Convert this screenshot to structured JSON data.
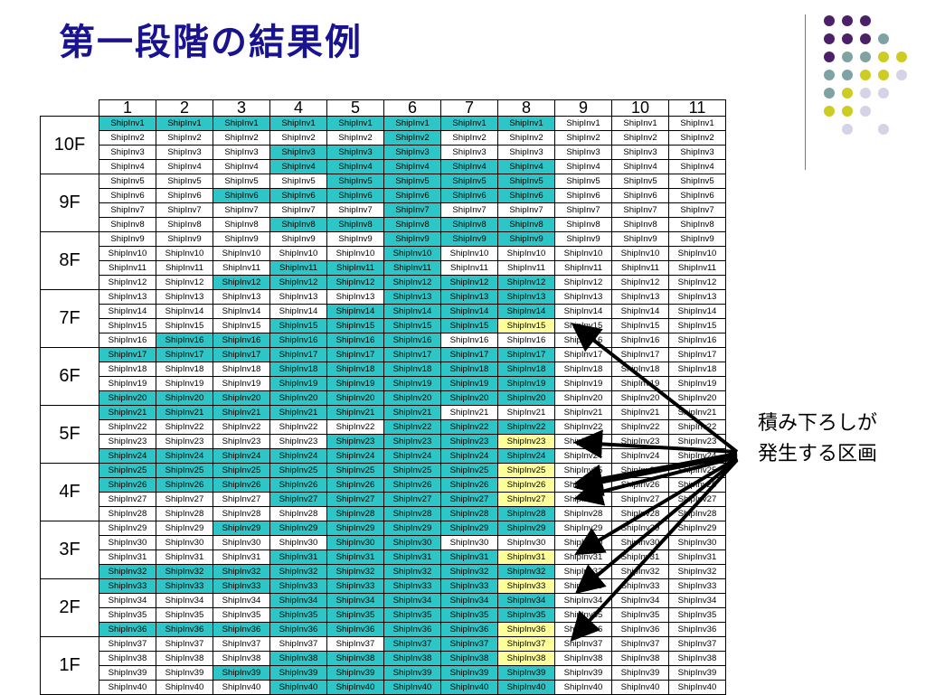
{
  "slide": {
    "title": "第一段階の結果例",
    "side_label_line1": "積み下ろしが",
    "side_label_line2": "発生する区画"
  },
  "colors": {
    "cyan": "#2ec5c6",
    "yellow": "#ffff99",
    "white": "#ffffff",
    "title": "#1a1390"
  },
  "grid": {
    "columns": [
      "1",
      "2",
      "3",
      "4",
      "5",
      "6",
      "7",
      "8",
      "9",
      "10",
      "11"
    ],
    "floors": [
      {
        "label": "10F",
        "rows": [
          {
            "text": "ShipInv1",
            "colors": "CCCCCCCCWWW"
          },
          {
            "text": "ShipInv2",
            "colors": "WWWWWCWWWWW"
          },
          {
            "text": "ShipInv3",
            "colors": "WWWCCCWWWWW"
          },
          {
            "text": "ShipInv4",
            "colors": "WWWCCCCCWWW"
          }
        ]
      },
      {
        "label": "9F",
        "rows": [
          {
            "text": "ShipInv5",
            "colors": "WWWWCCCCWWW"
          },
          {
            "text": "ShipInv6",
            "colors": "WWCCCCCCWWW"
          },
          {
            "text": "ShipInv7",
            "colors": "WWWWWCWWWWW"
          },
          {
            "text": "ShipInv8",
            "colors": "WWWCCCCCWWW"
          }
        ]
      },
      {
        "label": "8F",
        "rows": [
          {
            "text": "ShipInv9",
            "colors": "WWWWWCCCWWW"
          },
          {
            "text": "ShipInv10",
            "colors": "WWWWWCWWWWW"
          },
          {
            "text": "ShipInv11",
            "colors": "WWWCCCWWWWW"
          },
          {
            "text": "ShipInv12",
            "colors": "WWCCCCCCWWW"
          }
        ]
      },
      {
        "label": "7F",
        "rows": [
          {
            "text": "ShipInv13",
            "colors": "WWWWWCCCWWW"
          },
          {
            "text": "ShipInv14",
            "colors": "WWWWCCCCWWW"
          },
          {
            "text": "ShipInv15",
            "colors": "WWWCCCCYWWW"
          },
          {
            "text": "ShipInv16",
            "colors": "WCCCCCWWWWW"
          }
        ]
      },
      {
        "label": "6F",
        "rows": [
          {
            "text": "ShipInv17",
            "colors": "CCCCCCCCWWW"
          },
          {
            "text": "ShipInv18",
            "colors": "WWWCCCCCWWW"
          },
          {
            "text": "ShipInv19",
            "colors": "WWWCCCCCWWW"
          },
          {
            "text": "ShipInv20",
            "colors": "CCCCCCCCWWW"
          }
        ]
      },
      {
        "label": "5F",
        "rows": [
          {
            "text": "ShipInv21",
            "colors": "CCCCCCWWWWW"
          },
          {
            "text": "ShipInv22",
            "colors": "WWWWWCCCWWW"
          },
          {
            "text": "ShipInv23",
            "colors": "WWWWCCCYWWW"
          },
          {
            "text": "ShipInv24",
            "colors": "CCCCCCCCWWW"
          }
        ]
      },
      {
        "label": "4F",
        "rows": [
          {
            "text": "ShipInv25",
            "colors": "CCCCCCCYWWW"
          },
          {
            "text": "ShipInv26",
            "colors": "CCCCCCCYWWW"
          },
          {
            "text": "ShipInv27",
            "colors": "WWWCCCCYWWW"
          },
          {
            "text": "ShipInv28",
            "colors": "WWWWCCCCWWW"
          }
        ]
      },
      {
        "label": "3F",
        "rows": [
          {
            "text": "ShipInv29",
            "colors": "WWCCCCCCWWW"
          },
          {
            "text": "ShipInv30",
            "colors": "WWWWCCWWWWW"
          },
          {
            "text": "ShipInv31",
            "colors": "WWWCCCCYWWW"
          },
          {
            "text": "ShipInv32",
            "colors": "CCCCCCCCWWW"
          }
        ]
      },
      {
        "label": "2F",
        "rows": [
          {
            "text": "ShipInv33",
            "colors": "CCCCCCCYWWW"
          },
          {
            "text": "ShipInv34",
            "colors": "WWWCCCCCWWW"
          },
          {
            "text": "ShipInv35",
            "colors": "WWWCCCCCWWW"
          },
          {
            "text": "ShipInv36",
            "colors": "CCCCCCCYWWW"
          }
        ]
      },
      {
        "label": "1F",
        "rows": [
          {
            "text": "ShipInv37",
            "colors": "WWWWWCCYWWW"
          },
          {
            "text": "ShipInv38",
            "colors": "WWWCCCCYWWW"
          },
          {
            "text": "ShipInv39",
            "colors": "WWCCCCCCWWW"
          },
          {
            "text": "ShipInv40",
            "colors": "WWWCCCCCWWW"
          }
        ]
      }
    ]
  }
}
